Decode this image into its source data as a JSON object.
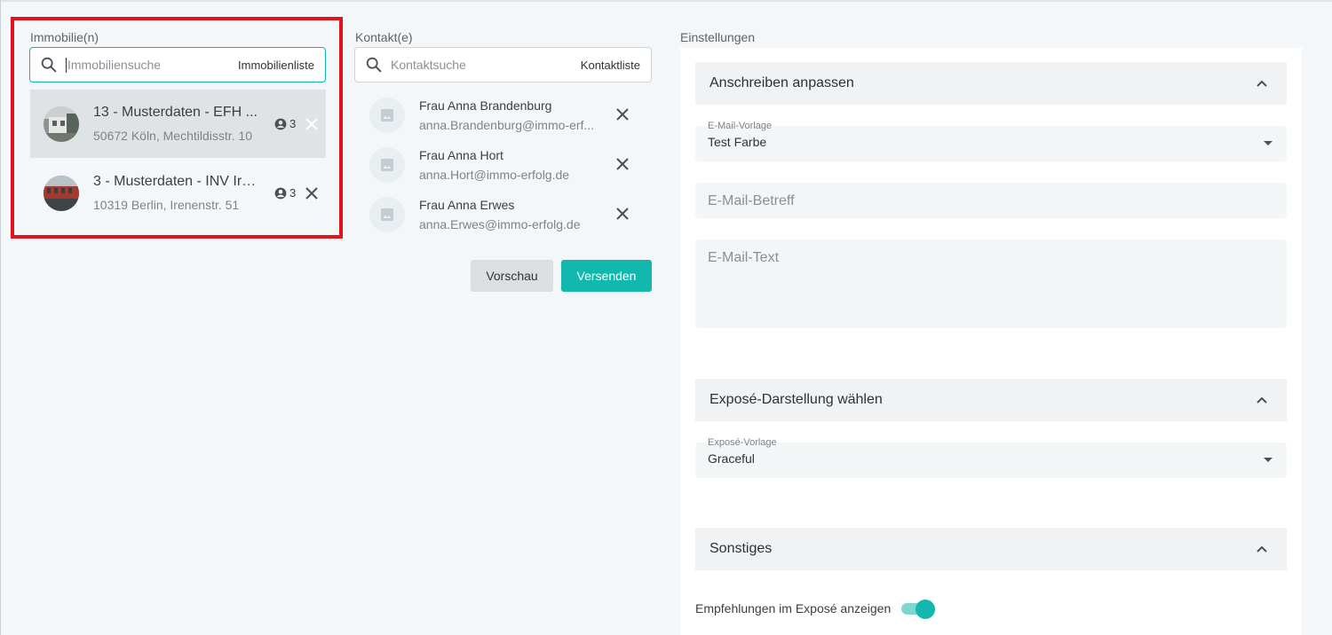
{
  "colors": {
    "accent": "#12b8ad",
    "highlight": "#e3131c"
  },
  "properties": {
    "label": "Immobilie(n)",
    "search": {
      "placeholder": "Immobiliensuche",
      "link": "Immobilienliste",
      "icon": "search-icon"
    },
    "items": [
      {
        "title": "13 - Musterdaten - EFH ...",
        "address": "50672 Köln, Mechtildisstr. 10",
        "count": "3",
        "selected": true
      },
      {
        "title": "3 - Musterdaten - INV Ire...",
        "address": "10319 Berlin, Irenenstr. 51",
        "count": "3",
        "selected": false
      }
    ]
  },
  "contacts": {
    "label": "Kontakt(e)",
    "search": {
      "placeholder": "Kontaktsuche",
      "link": "Kontaktliste",
      "icon": "search-icon"
    },
    "items": [
      {
        "name": "Frau Anna Brandenburg",
        "email": "anna.Brandenburg@immo-erf..."
      },
      {
        "name": "Frau Anna Hort",
        "email": "anna.Hort@immo-erfolg.de"
      },
      {
        "name": "Frau Anna Erwes",
        "email": "anna.Erwes@immo-erfolg.de"
      }
    ],
    "preview_label": "Vorschau",
    "send_label": "Versenden"
  },
  "settings": {
    "label": "Einstellungen",
    "letter": {
      "title": "Anschreiben anpassen",
      "template_label": "E-Mail-Vorlage",
      "template_value": "Test Farbe",
      "subject_placeholder": "E-Mail-Betreff",
      "text_placeholder": "E-Mail-Text"
    },
    "expose": {
      "title": "Exposé-Darstellung wählen",
      "template_label": "Exposé-Vorlage",
      "template_value": "Graceful"
    },
    "misc": {
      "title": "Sonstiges",
      "recommendations_label": "Empfehlungen im Exposé anzeigen",
      "recommendations_enabled": true
    }
  }
}
